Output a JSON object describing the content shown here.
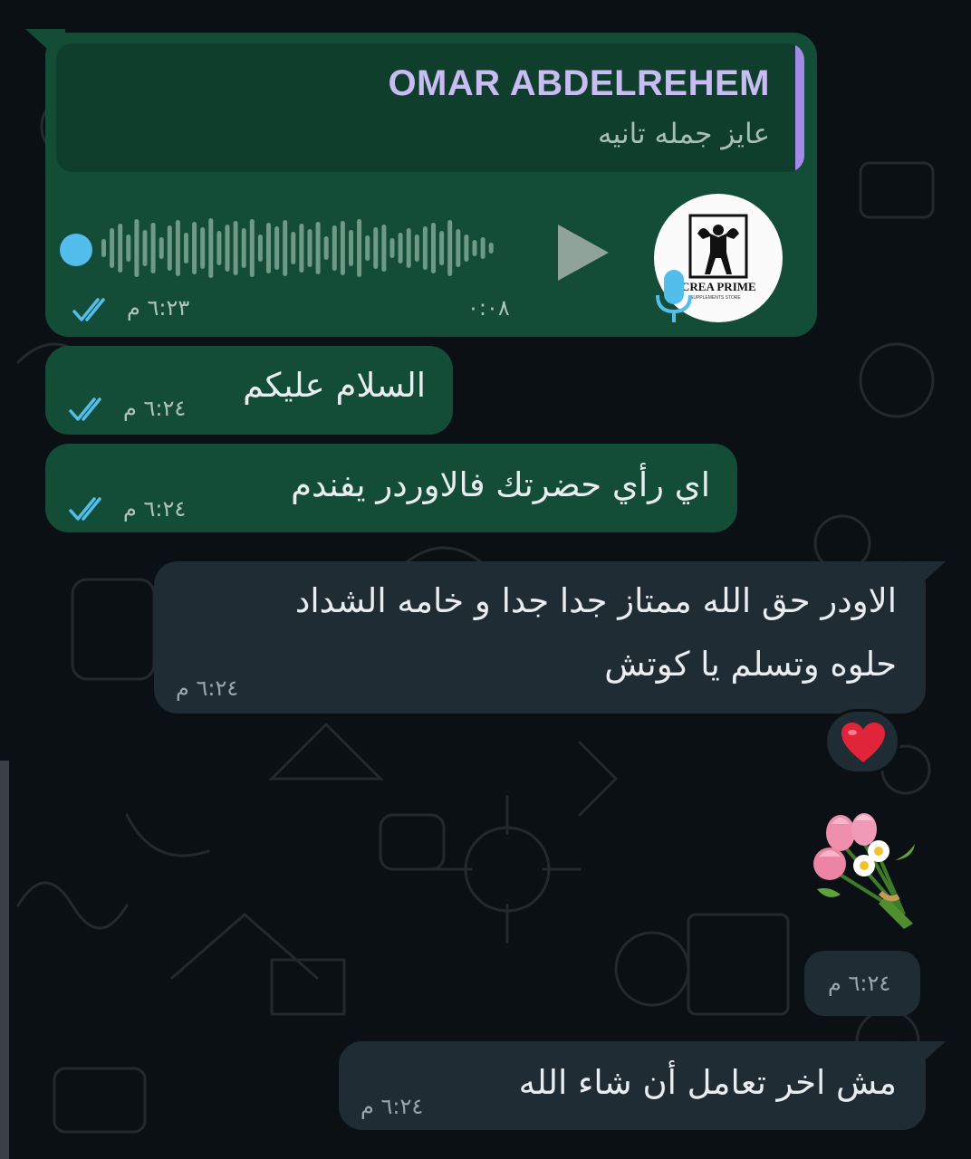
{
  "messages": [
    {
      "type": "voice",
      "quote": {
        "sender": "OMAR ABDELREHEM",
        "text": "عايز جمله تانيه"
      },
      "avatar": {
        "logo": "CREA PRIME",
        "tagline": "SUPPLEMENTS STORE"
      },
      "duration": "٠:٠٨",
      "time": "٦:٢٣ م",
      "status": "read"
    },
    {
      "type": "text",
      "direction": "outgoing",
      "text": "السلام عليكم",
      "time": "٦:٢٤ م",
      "status": "read"
    },
    {
      "type": "text",
      "direction": "outgoing",
      "text": "اي رأي حضرتك فالاوردر يفندم",
      "time": "٦:٢٤ م",
      "status": "read"
    },
    {
      "type": "text",
      "direction": "incoming",
      "lines": [
        "الاودر حق الله ممتاز جدا جدا و خامه الشداد",
        "حلوه وتسلم يا كوتش"
      ],
      "time": "٦:٢٤ م",
      "reaction": "❤️"
    },
    {
      "type": "sticker",
      "direction": "incoming",
      "sticker": "flower-bouquet",
      "time": "٦:٢٤ م"
    },
    {
      "type": "text",
      "direction": "incoming",
      "text": "مش اخر تعامل أن شاء الله",
      "time": "٦:٢٤ م"
    }
  ],
  "colors": {
    "background": "#0b1014",
    "outgoing_bubble": "#144d37",
    "incoming_bubble": "#1f2c34",
    "quote_accent": "#a48ae8",
    "read_ticks": "#53bdeb"
  }
}
